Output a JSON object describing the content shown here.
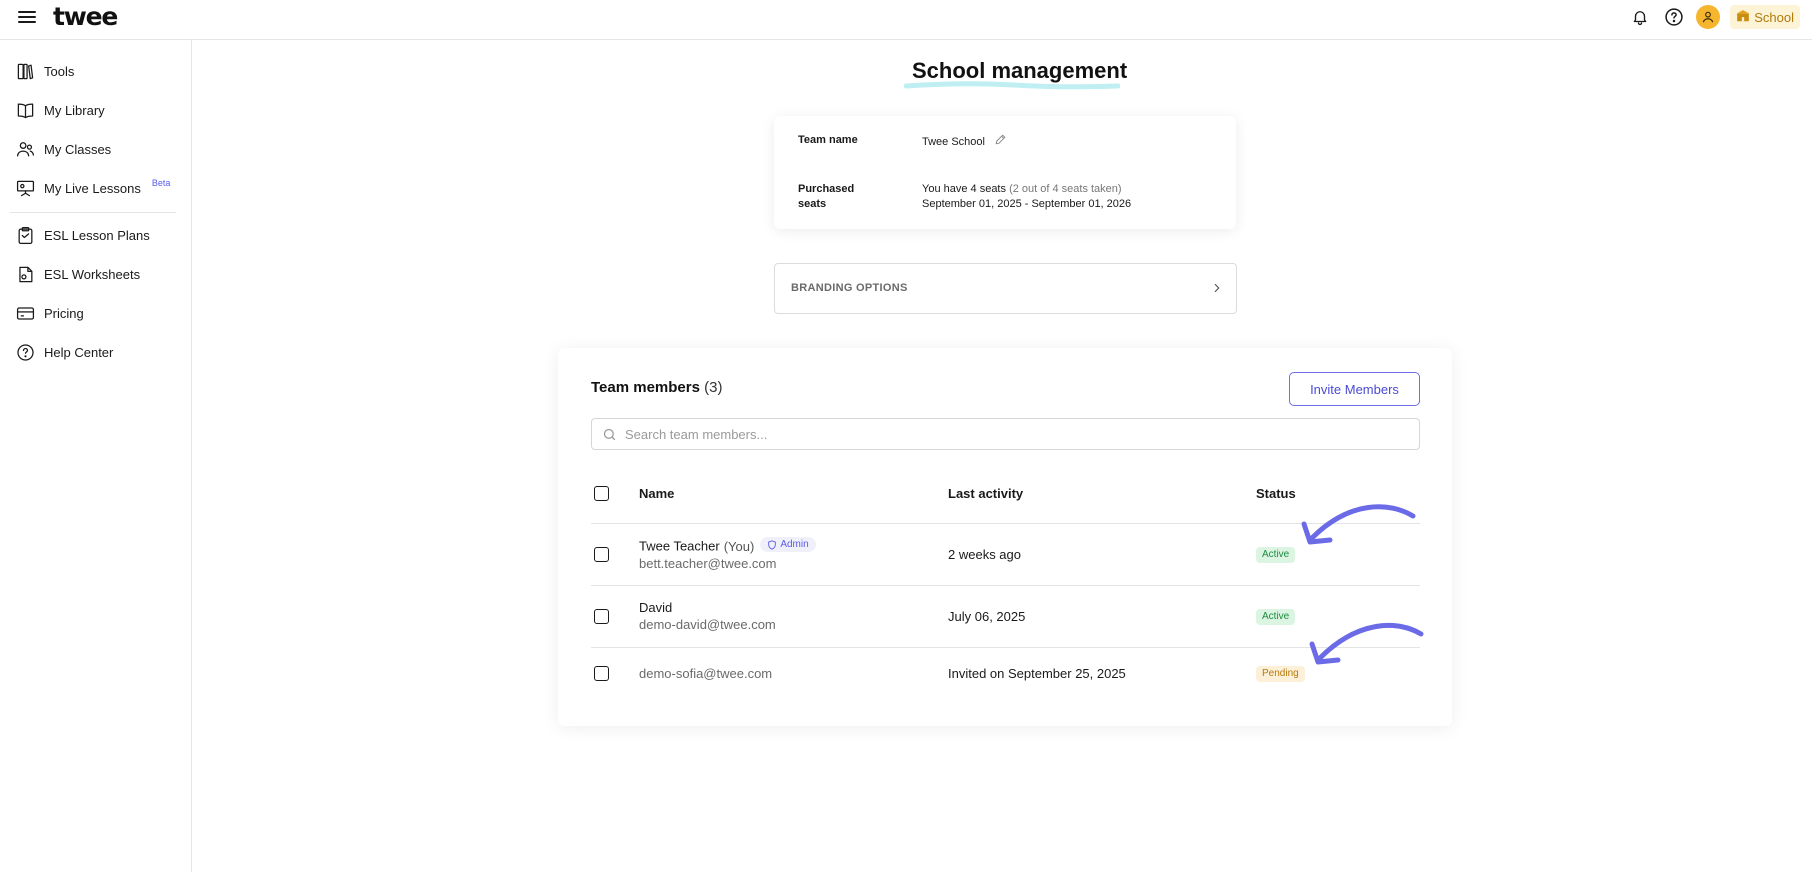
{
  "app": {
    "logo": "twee"
  },
  "header": {
    "school_label": "School"
  },
  "sidebar": {
    "items": [
      {
        "label": "Tools",
        "icon": "tools-icon"
      },
      {
        "label": "My Library",
        "icon": "book-icon"
      },
      {
        "label": "My Classes",
        "icon": "users-icon"
      },
      {
        "label": "My Live Lessons",
        "icon": "presentation-icon",
        "badge": "Beta"
      },
      {
        "label": "ESL Lesson Plans",
        "icon": "clipboard-icon"
      },
      {
        "label": "ESL Worksheets",
        "icon": "document-icon"
      },
      {
        "label": "Pricing",
        "icon": "card-icon"
      },
      {
        "label": "Help Center",
        "icon": "help-icon"
      }
    ]
  },
  "page": {
    "title": "School management"
  },
  "team_info": {
    "team_name_label": "Team name",
    "team_name_value": "Twee School",
    "seats_label": "Purchased seats",
    "seats_text": "You have 4 seats",
    "seats_taken": "(2 out of 4 seats taken)",
    "seats_period": "September 01, 2025 - September 01, 2026"
  },
  "branding": {
    "label": "BRANDING OPTIONS"
  },
  "members": {
    "title": "Team members",
    "count": "(3)",
    "invite_label": "Invite Members",
    "search_placeholder": "Search team members...",
    "columns": {
      "name": "Name",
      "activity": "Last activity",
      "status": "Status"
    },
    "rows": [
      {
        "name": "Twee Teacher",
        "you": "(You)",
        "role": "Admin",
        "email": "bett.teacher@twee.com",
        "activity": "2 weeks ago",
        "status": "Active"
      },
      {
        "name": "David",
        "email": "demo-david@twee.com",
        "activity": "July 06, 2025",
        "status": "Active"
      },
      {
        "email": "demo-sofia@twee.com",
        "activity": "Invited on September 25, 2025",
        "status": "Pending"
      }
    ]
  },
  "colors": {
    "accent": "#5b5ce8",
    "active_bg": "#dcf5e3",
    "active_text": "#1b8a3e",
    "pending_bg": "#fdf0d8",
    "pending_text": "#b5780c",
    "avatar": "#f5b52e"
  }
}
